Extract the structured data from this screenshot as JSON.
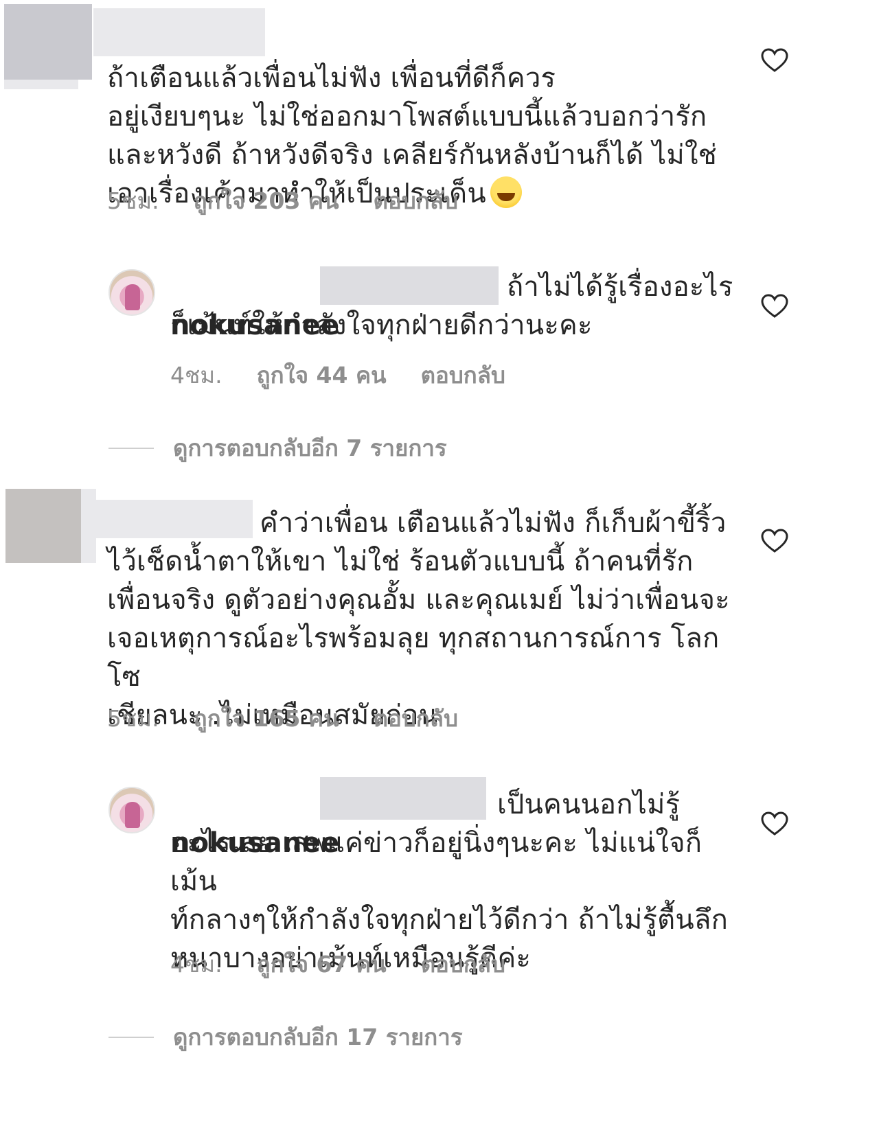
{
  "comments": [
    {
      "text": "ถ้าเตือนแล้วเพื่อนไม่ฟัง เพื่อนที่ดีก็ควร\nอยู่เงียบๆนะ ไม่ใช่ออกมาโพสต์แบบนี้แล้วบอกว่ารัก\nและหวังดี ถ้าหวังดีจริง เคลียร์กันหลังบ้านก็ได้ ไม่ใช่\nเอาเรื่องเค้ามาทำให้เป็นประเด็น",
      "time": "5ชม.",
      "likes": "ถูกใจ 203 คน",
      "reply_label": "ตอบกลับ"
    },
    {
      "username": "nokusanee",
      "text": "ถ้าไม่ได้รู้เรื่องอะไร\nก็เม้นท์ให้กำลังใจทุกฝ่ายดีกว่านะคะ",
      "time": "4ชม.",
      "likes": "ถูกใจ 44 คน",
      "reply_label": "ตอบกลับ"
    },
    {
      "text": "คำว่าเพื่อน เตือนแล้วไม่ฟัง  ก็เก็บผ้าขี้ริ้ว\nไว้เช็ดน้ำตาให้เขา ไม่ใช่ ร้อนตัวแบบนี้ ถ้าคนที่รัก\nเพื่อนจริง  ดูตัวอย่างคุณอั้ม และคุณเมย์  ไม่ว่าเพื่อนจะ\nเจอเหตุการณ์อะไรพร้อมลุย ทุกสถานการณ์การ โลกโซ\nเชียลนะ .ไม่เหมือนสมัยก่อน",
      "time": "5ชม.",
      "likes": "ถูกใจ 165 คน",
      "reply_label": "ตอบกลับ"
    },
    {
      "username": "nokusanee",
      "text": "เป็นคนนอกไม่รู้\nอะไรเลย เสพแค่ข่าวก็อยู่นิ่งๆนะคะ ไม่แน่ใจก็เม้น\nท์กลางๆให้กำลังใจทุกฝ่ายไว้ดีกว่า ถ้าไม่รู้ตื้นลึก\nหนาบางอย่าเม้นท์เหมือนรู้ดีค่ะ",
      "time": "4ชม.",
      "likes": "ถูกใจ 67 คน",
      "reply_label": "ตอบกลับ"
    }
  ],
  "view_more": [
    "ดูการตอบกลับอีก 7 รายการ",
    "ดูการตอบกลับอีก 17 รายการ"
  ],
  "icons": {
    "heart": "heart-outline-icon",
    "emoji": "grinning-face-with-sweat-emoji"
  },
  "colors": {
    "text": "#262626",
    "meta": "#8e8e8e"
  }
}
